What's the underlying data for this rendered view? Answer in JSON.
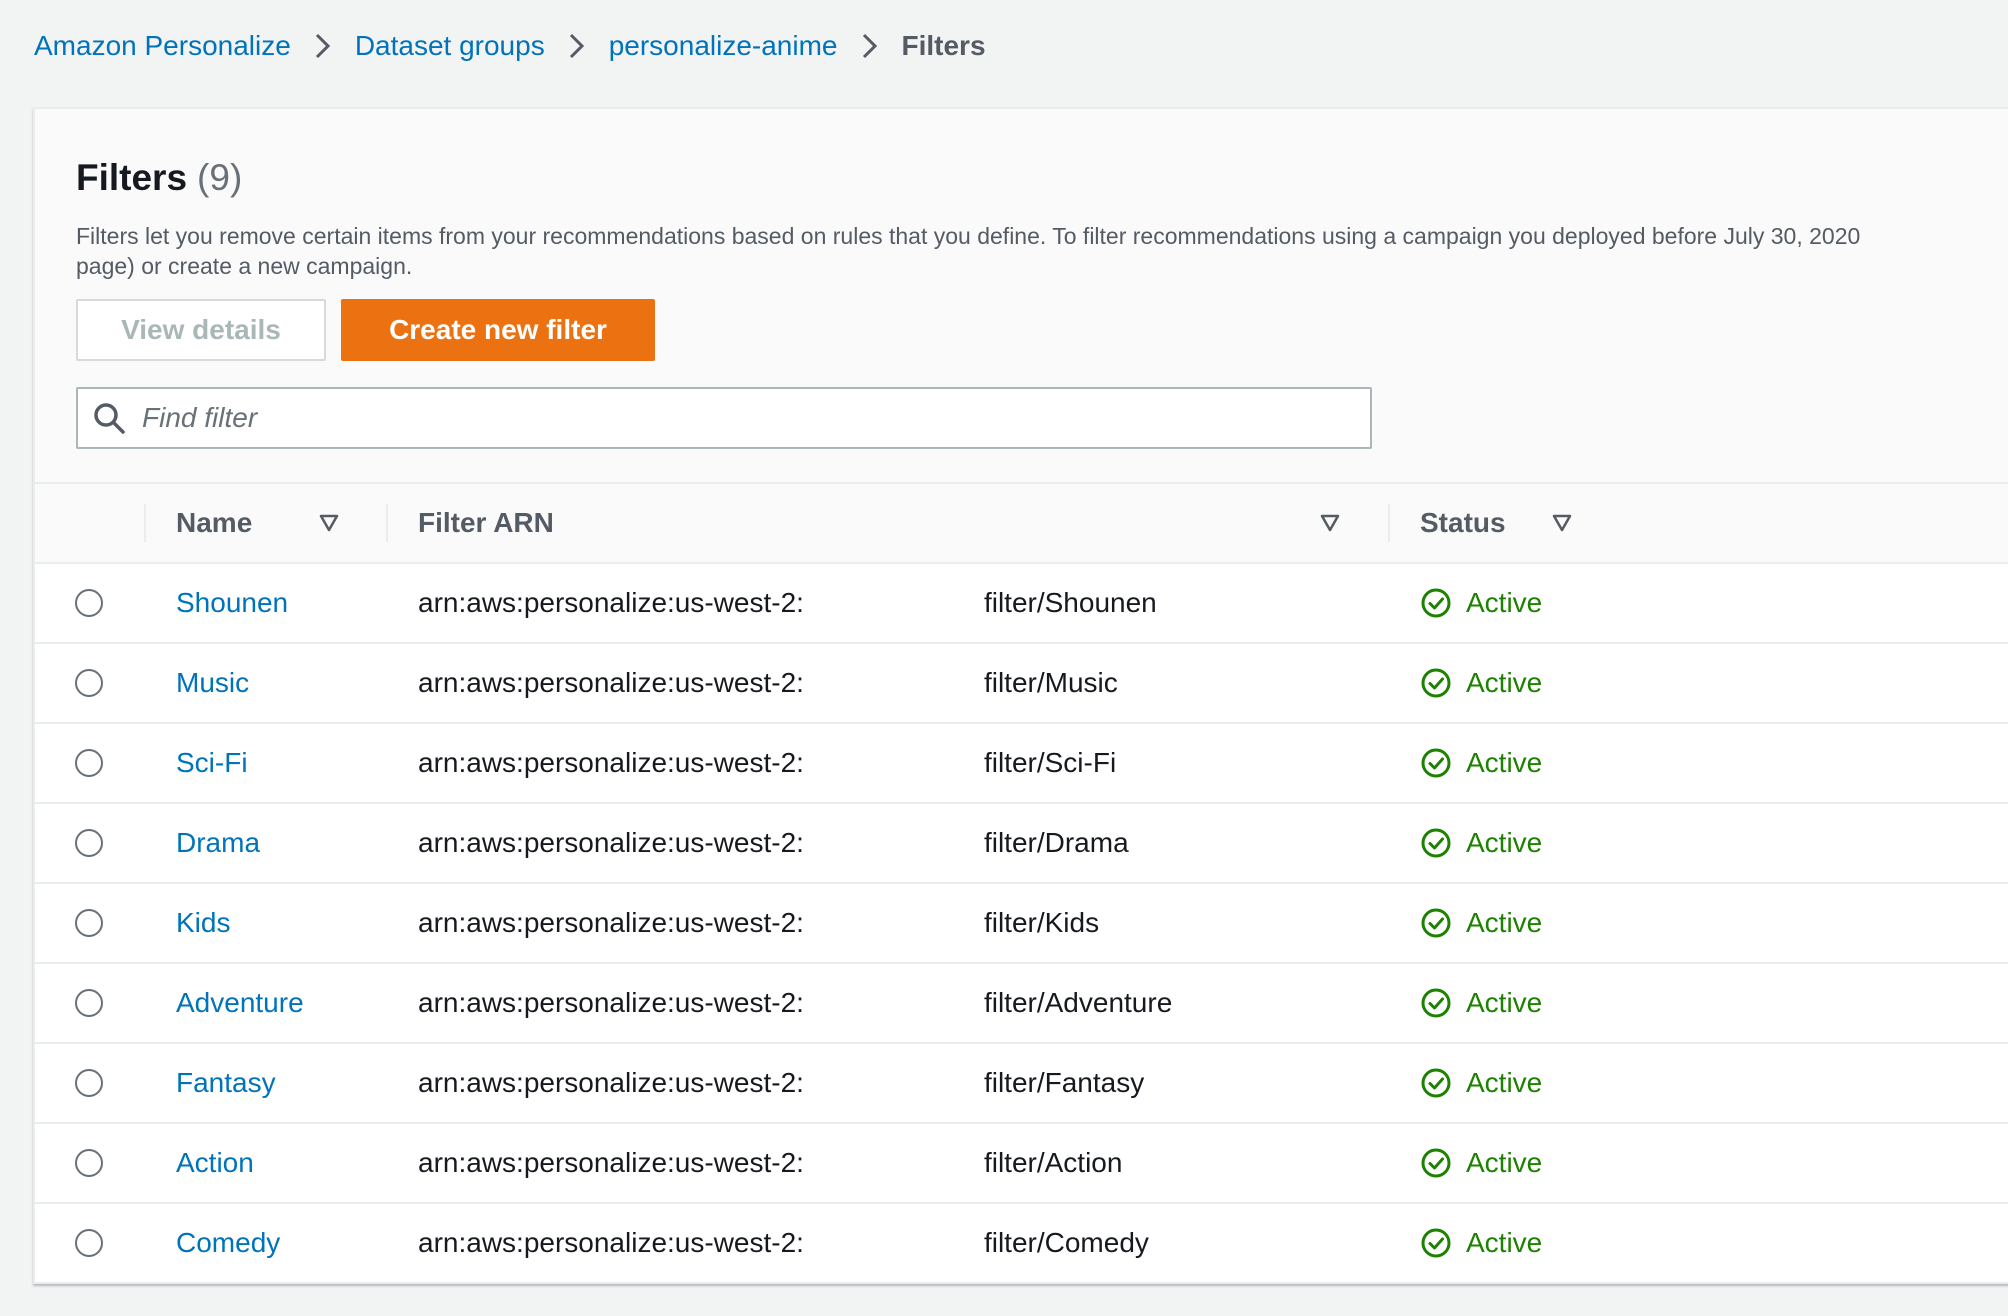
{
  "breadcrumb": {
    "items": [
      "Amazon Personalize",
      "Dataset groups",
      "personalize-anime"
    ],
    "current": "Filters"
  },
  "header": {
    "title": "Filters",
    "count": "(9)",
    "description": "Filters let you remove certain items from your recommendations based on rules that you define. To filter recommendations using a campaign you deployed before July 30, 2020",
    "description_line2": "page) or create a new campaign."
  },
  "buttons": {
    "view_details": "View details",
    "create_new_filter": "Create new filter"
  },
  "search": {
    "placeholder": "Find filter"
  },
  "table": {
    "columns": [
      "Name",
      "Filter ARN",
      "Status"
    ],
    "rows": [
      {
        "name": "Shounen",
        "arn_prefix": "arn:aws:personalize:us-west-2:",
        "arn_suffix": "filter/Shounen",
        "status": "Active"
      },
      {
        "name": "Music",
        "arn_prefix": "arn:aws:personalize:us-west-2:",
        "arn_suffix": "filter/Music",
        "status": "Active"
      },
      {
        "name": "Sci-Fi",
        "arn_prefix": "arn:aws:personalize:us-west-2:",
        "arn_suffix": "filter/Sci-Fi",
        "status": "Active"
      },
      {
        "name": "Drama",
        "arn_prefix": "arn:aws:personalize:us-west-2:",
        "arn_suffix": "filter/Drama",
        "status": "Active"
      },
      {
        "name": "Kids",
        "arn_prefix": "arn:aws:personalize:us-west-2:",
        "arn_suffix": "filter/Kids",
        "status": "Active"
      },
      {
        "name": "Adventure",
        "arn_prefix": "arn:aws:personalize:us-west-2:",
        "arn_suffix": "filter/Adventure",
        "status": "Active"
      },
      {
        "name": "Fantasy",
        "arn_prefix": "arn:aws:personalize:us-west-2:",
        "arn_suffix": "filter/Fantasy",
        "status": "Active"
      },
      {
        "name": "Action",
        "arn_prefix": "arn:aws:personalize:us-west-2:",
        "arn_suffix": "filter/Action",
        "status": "Active"
      },
      {
        "name": "Comedy",
        "arn_prefix": "arn:aws:personalize:us-west-2:",
        "arn_suffix": "filter/Comedy",
        "status": "Active"
      }
    ]
  },
  "colors": {
    "link": "#0073bb",
    "primary_button": "#ec7211",
    "status_active": "#1d8102"
  }
}
